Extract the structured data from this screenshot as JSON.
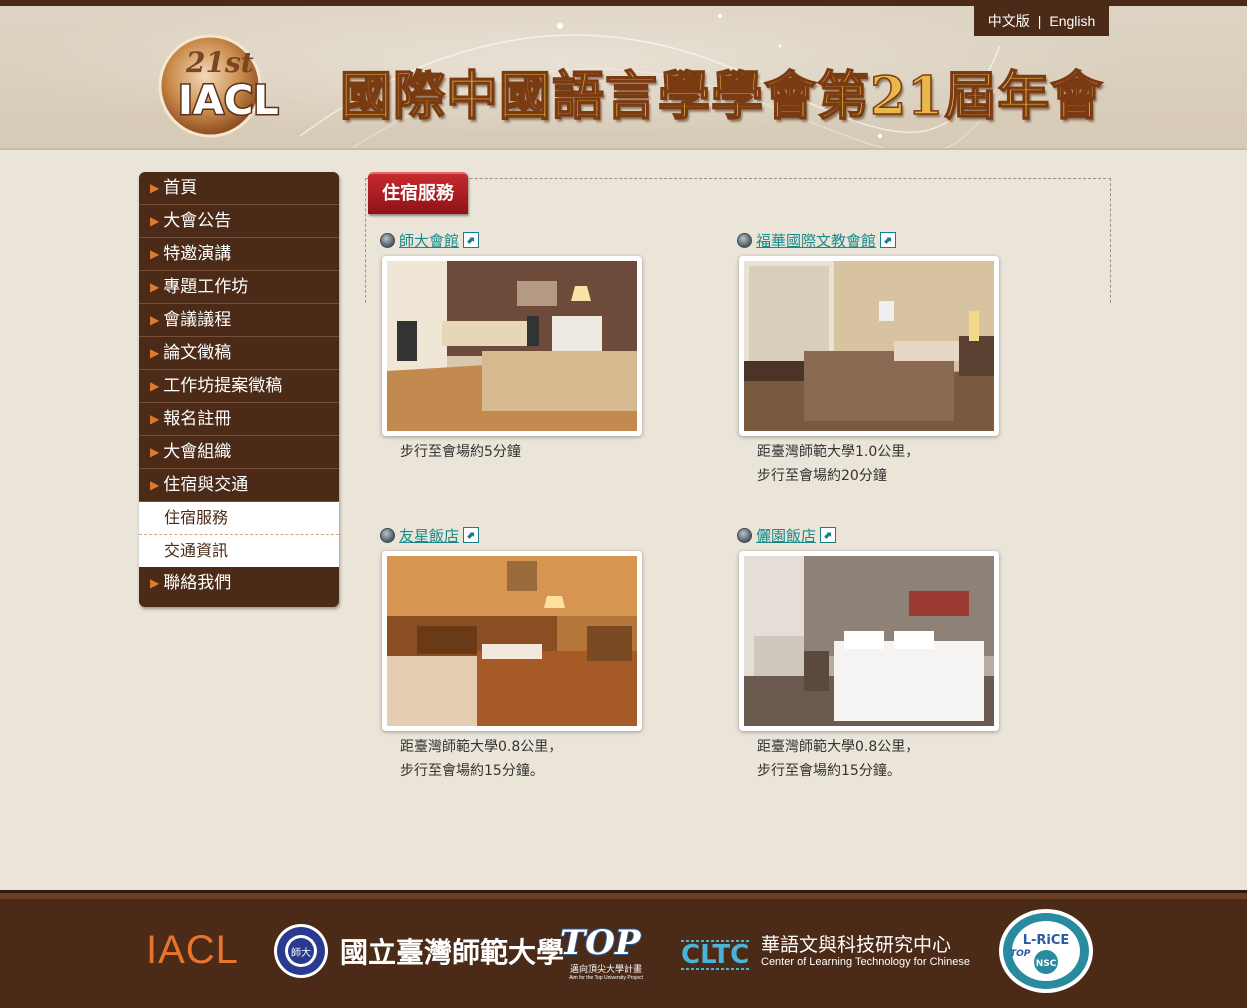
{
  "header": {
    "logo_text_top": "21st",
    "logo_text_main": "IACL",
    "site_title": "國際中國語言學學會第21屆年會",
    "lang_zh": "中文版",
    "lang_sep": "|",
    "lang_en": "English"
  },
  "nav": {
    "items": [
      {
        "label": "首頁"
      },
      {
        "label": "大會公告"
      },
      {
        "label": "特邀演講"
      },
      {
        "label": "專題工作坊"
      },
      {
        "label": "會議議程"
      },
      {
        "label": "論文徵稿"
      },
      {
        "label": "工作坊提案徵稿"
      },
      {
        "label": "報名註冊"
      },
      {
        "label": "大會組織"
      },
      {
        "label": "住宿與交通"
      }
    ],
    "sub_items": [
      {
        "label": "住宿服務"
      },
      {
        "label": "交通資訊"
      }
    ],
    "last_item": {
      "label": "聯絡我們"
    }
  },
  "section": {
    "title": "住宿服務"
  },
  "hotels": [
    {
      "name": "師大會館",
      "line1": "步行至會場約5分鐘",
      "line2": ""
    },
    {
      "name": "福華國際文教會館",
      "line1": "距臺灣師範大學1.0公里，",
      "line2": "步行至會場約20分鐘"
    },
    {
      "name": "友星飯店",
      "line1": "距臺灣師範大學0.8公里，",
      "line2": "步行至會場約15分鐘。"
    },
    {
      "name": "儷園飯店",
      "line1": "距臺灣師範大學0.8公里，",
      "line2": "步行至會場約15分鐘。"
    }
  ],
  "footer": {
    "iacl": "IACL",
    "ntnu": "國立臺灣師範大學",
    "ntnu_seal": "師大",
    "top_logo": "TOP",
    "top_sub": "邁向頂尖大學計畫",
    "top_en": "Aim for the Top University Project",
    "clt_abbr": "CLTC",
    "clt_name": "華語文與科技研究中心",
    "clt_en": "Center of Learning Technology for Chinese",
    "lrice": "L-RiCE",
    "nsc": "NSC",
    "top_badge": "TOP"
  },
  "colors": {
    "brown": "#4b2a17",
    "accent_orange": "#e07a2b",
    "tab_red": "#a81d22",
    "link_teal": "#188a8a"
  },
  "icons": [
    "arrow-right-icon",
    "bullet-icon",
    "external-link-icon"
  ]
}
